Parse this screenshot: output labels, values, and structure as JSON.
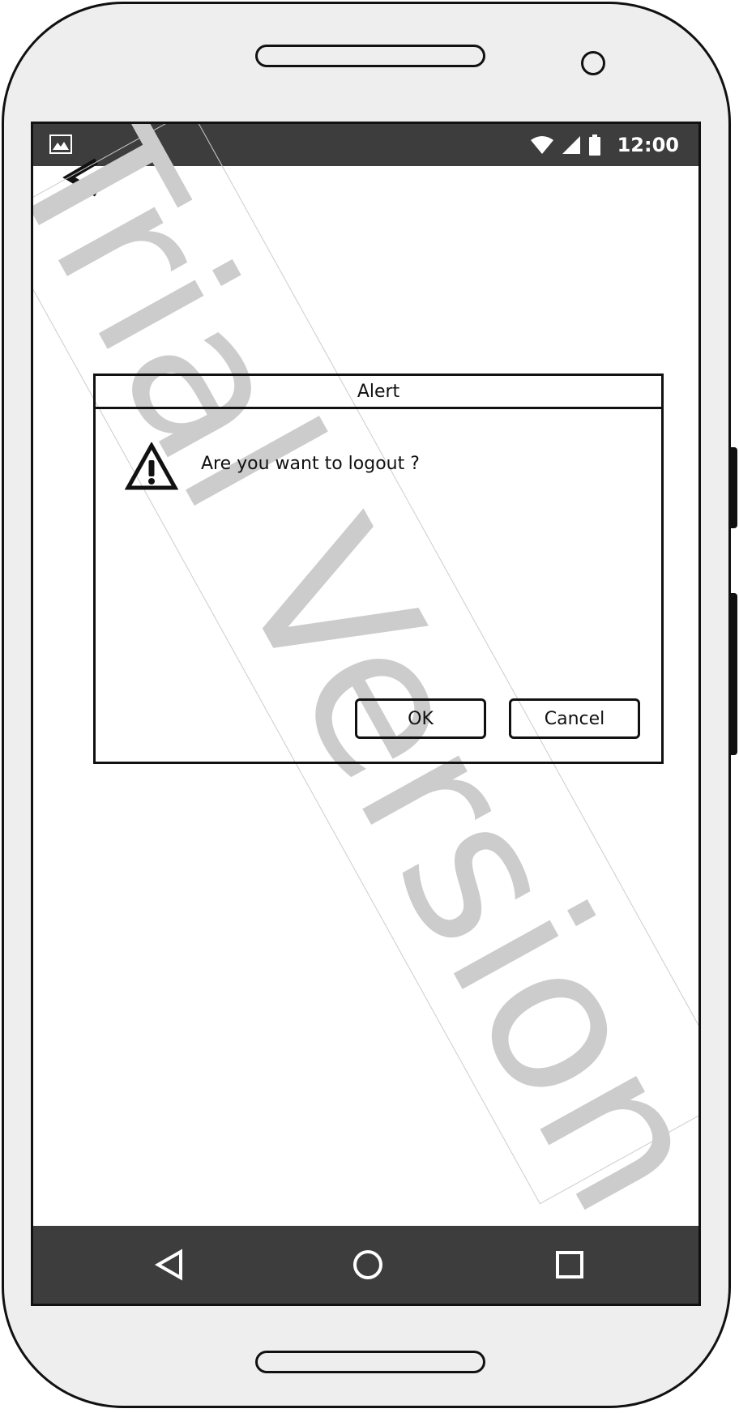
{
  "status_bar": {
    "time": "12:00",
    "icons": [
      "image-icon",
      "wifi-icon",
      "signal-icon",
      "battery-icon"
    ]
  },
  "app_bar": {
    "back_icon": "chevron-left-icon"
  },
  "watermark": {
    "text": "Trial Version",
    "color": "#cccccc"
  },
  "dialog": {
    "title": "Alert",
    "icon": "warning-icon",
    "message": "Are you want to logout ?",
    "ok_label": "OK",
    "cancel_label": "Cancel"
  },
  "nav_bar": {
    "icons": [
      "nav-back-icon",
      "nav-home-icon",
      "nav-recents-icon"
    ]
  },
  "colors": {
    "bars": "#3d3d3d",
    "device_body": "#eeeeee",
    "outline": "#111111"
  }
}
